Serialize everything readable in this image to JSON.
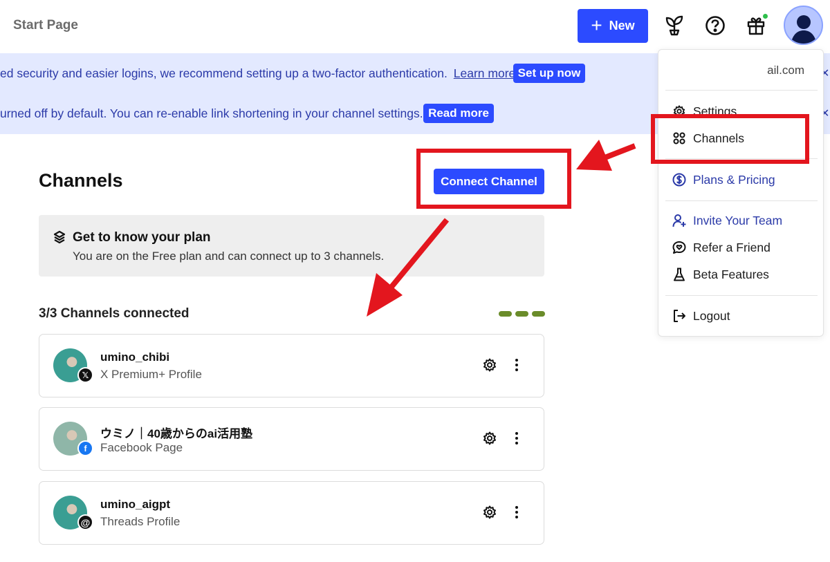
{
  "header": {
    "title": "Start Page",
    "new_button": "New"
  },
  "banners": [
    {
      "text": "ed security and easier logins, we recommend setting up a two-factor authentication.",
      "link": "Learn more",
      "button": "Set up now"
    },
    {
      "text": "urned off by default. You can re-enable link shortening in your channel settings.",
      "button": "Read more"
    }
  ],
  "main": {
    "title": "Channels",
    "connect_button": "Connect Channel",
    "plan": {
      "title": "Get to know your plan",
      "description": "You are on the Free plan and can connect up to 3 channels."
    },
    "connected_label": "3/3 Channels connected",
    "channels_connected": 3,
    "channels_limit": 3,
    "channels": [
      {
        "name": "umino_chibi",
        "type": "X Premium+ Profile",
        "network": "x-icon",
        "badge_color": "#111111"
      },
      {
        "name": "ウミノ｜40歳からのai活用塾",
        "type": "Facebook Page",
        "network": "facebook-icon",
        "badge_color": "#1877f2"
      },
      {
        "name": "umino_aigpt",
        "type": "Threads Profile",
        "network": "threads-icon",
        "badge_color": "#111111"
      }
    ]
  },
  "menu": {
    "email": "ail.com",
    "items": [
      {
        "label": "Settings",
        "icon": "gear-icon"
      },
      {
        "label": "Channels",
        "icon": "grid-icon"
      },
      {
        "label": "Plans & Pricing",
        "icon": "dollar-icon"
      },
      {
        "label": "Invite Your Team",
        "icon": "add-user-icon"
      },
      {
        "label": "Refer a Friend",
        "icon": "chat-icon"
      },
      {
        "label": "Beta Features",
        "icon": "flask-icon"
      },
      {
        "label": "Logout",
        "icon": "logout-icon"
      }
    ]
  },
  "colors": {
    "accent": "#2c4bff",
    "banner_bg": "#e3e9ff",
    "annotation": "#e3161e",
    "progress": "#6a8c2a"
  }
}
